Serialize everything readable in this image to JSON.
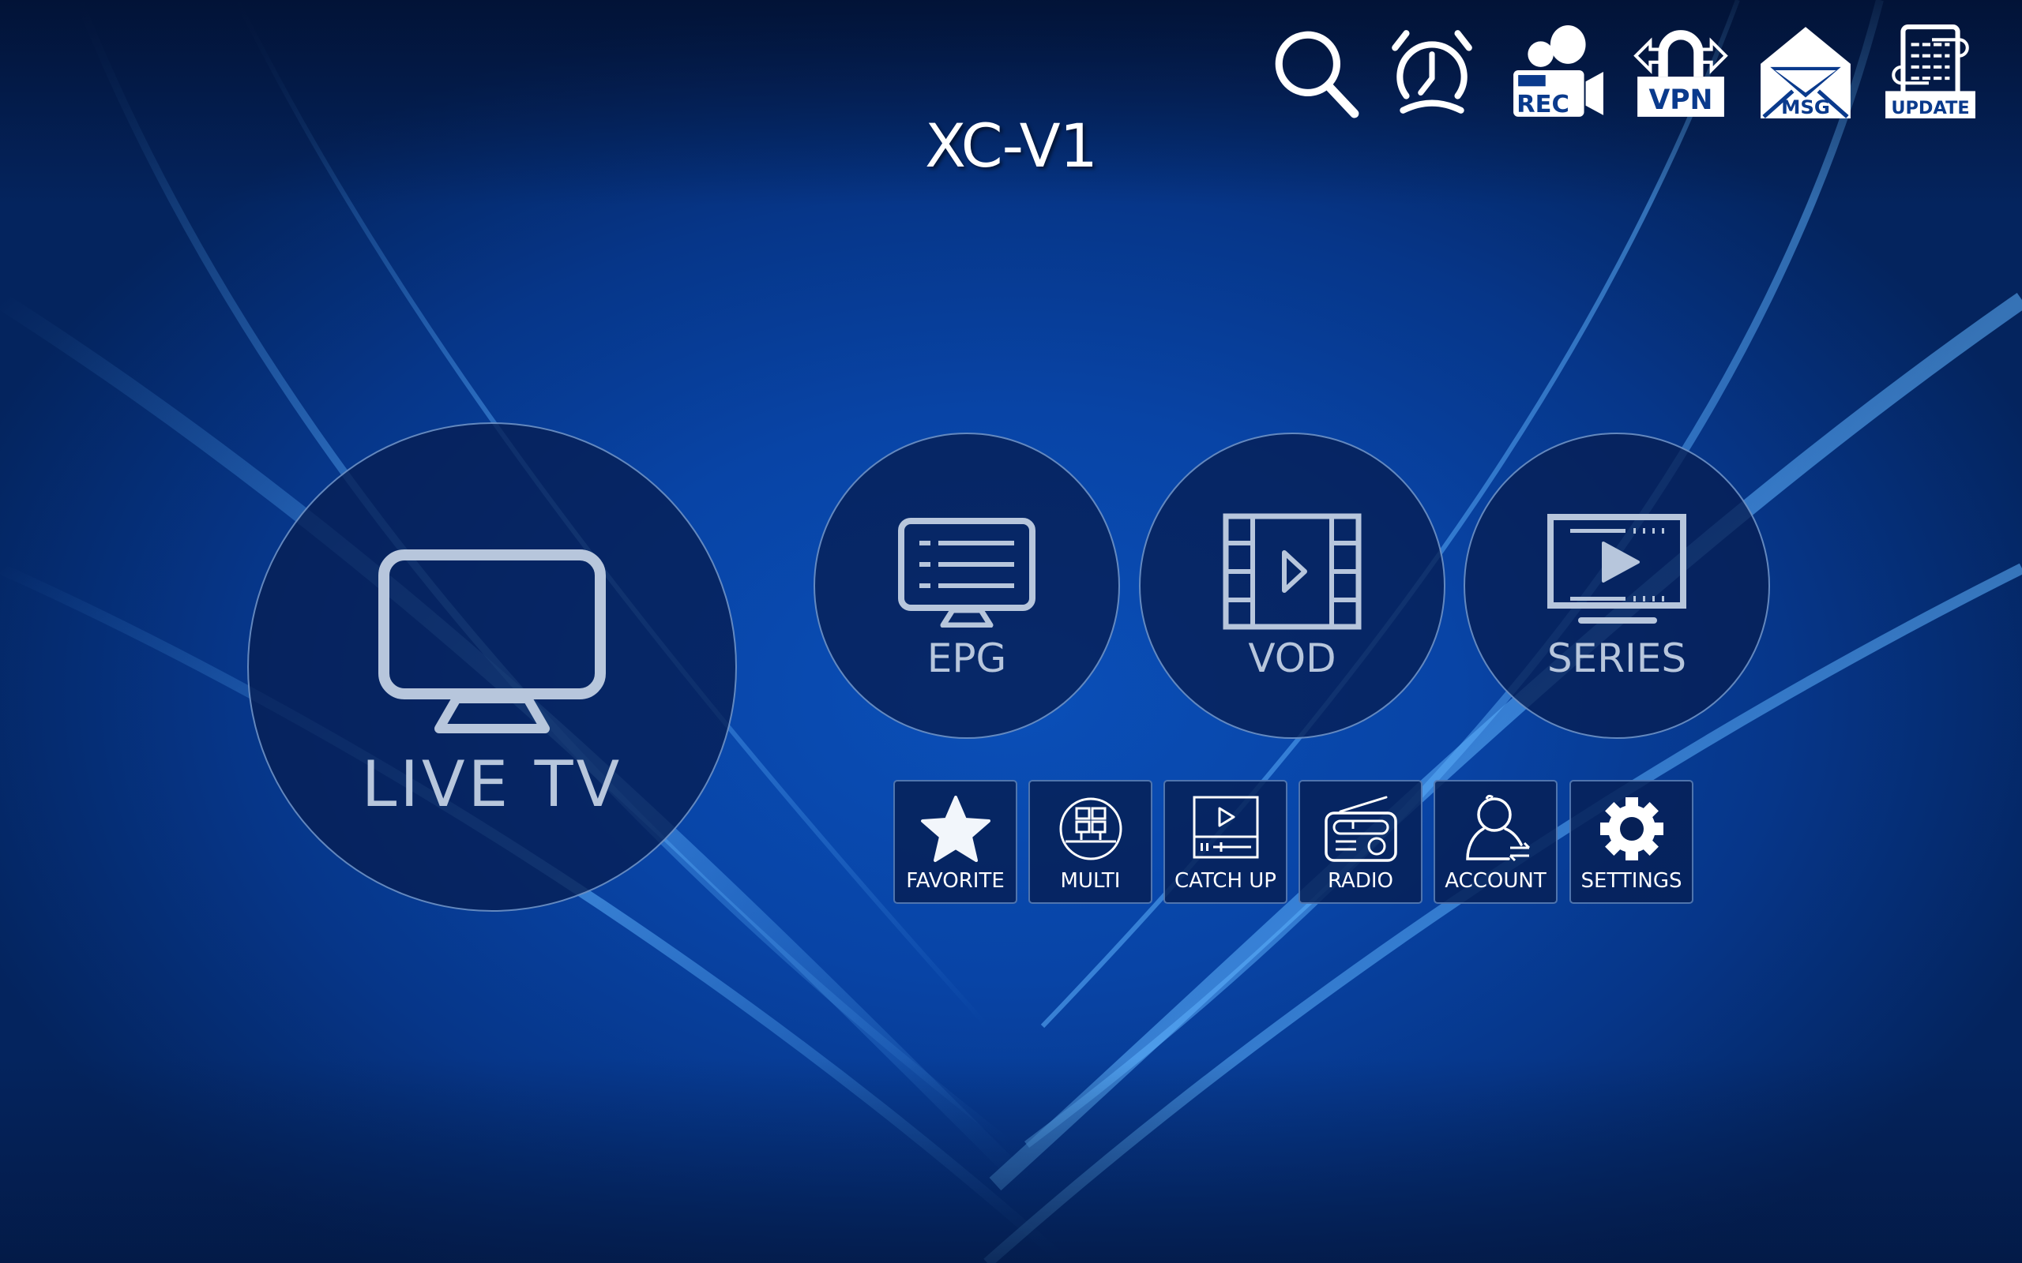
{
  "app": {
    "title": "XC-V1"
  },
  "top_bar": {
    "items": [
      {
        "id": "search",
        "label": "",
        "icon": "search-icon"
      },
      {
        "id": "alarm",
        "label": "",
        "icon": "alarm-clock-icon"
      },
      {
        "id": "rec",
        "label": "REC",
        "icon": "record-camera-icon"
      },
      {
        "id": "vpn",
        "label": "VPN",
        "icon": "vpn-lock-icon"
      },
      {
        "id": "msg",
        "label": "MSG",
        "icon": "envelope-icon"
      },
      {
        "id": "update",
        "label": "UPDATE",
        "icon": "update-document-icon"
      }
    ]
  },
  "main_menu": {
    "live_tv": {
      "label": "LIVE TV",
      "icon": "tv-icon"
    },
    "epg": {
      "label": "EPG",
      "icon": "epg-monitor-icon"
    },
    "vod": {
      "label": "VOD",
      "icon": "film-play-icon"
    },
    "series": {
      "label": "SERIES",
      "icon": "series-screen-icon"
    }
  },
  "tiles": [
    {
      "label": "FAVORITE",
      "icon": "star-icon"
    },
    {
      "label": "MULTI",
      "icon": "multiscreen-icon"
    },
    {
      "label": "CATCH UP",
      "icon": "catchup-player-icon"
    },
    {
      "label": "RADIO",
      "icon": "radio-icon"
    },
    {
      "label": "ACCOUNT",
      "icon": "account-switch-icon"
    },
    {
      "label": "SETTINGS",
      "icon": "gear-icon"
    }
  ],
  "colors": {
    "background": "#0844a6",
    "circle_fill": "#061e52",
    "circle_text": "#b7c6dc",
    "tile_fill": "#062056",
    "icon_white": "#ffffff"
  }
}
